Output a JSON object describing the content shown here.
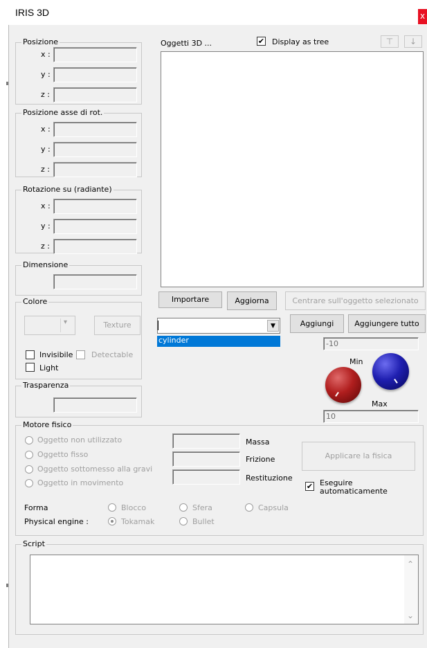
{
  "window": {
    "title": "IRIS 3D",
    "close_glyph": "x"
  },
  "left": {
    "posizione": {
      "legend": "Posizione",
      "labels": [
        "x :",
        "y :",
        "z :"
      ]
    },
    "asse": {
      "legend": "Posizione asse di rot.",
      "labels": [
        "x :",
        "y :",
        "z :"
      ]
    },
    "rotazione": {
      "legend": "Rotazione su (radiante)",
      "labels": [
        "x :",
        "y :",
        "z :"
      ]
    },
    "dimensione": {
      "legend": "Dimensione"
    },
    "colore": {
      "legend": "Colore",
      "texture": "Texture",
      "invisibile": "Invisibile",
      "detectable": "Detectable",
      "light": "Light"
    },
    "trasparenza": {
      "legend": "Trasparenza"
    }
  },
  "objects": {
    "label": "Oggetti 3D ...",
    "display_tree": "Display as tree",
    "display_tree_checked": true,
    "up_icon": "up-arrow-icon",
    "down_icon": "down-arrow-icon"
  },
  "actions": {
    "importare": "Importare",
    "aggiorna": "Aggiorna",
    "centrare": "Centrare sull'oggetto selezionato",
    "aggiungi": "Aggiungi",
    "aggiungere_tutto": "Aggiungere tutto"
  },
  "combo": {
    "value": "",
    "option": "cylinder"
  },
  "range": {
    "min_value": "-10",
    "max_value": "10",
    "min_label": "Min",
    "max_label": "Max",
    "min_knob_color": "#b01e1e",
    "max_knob_color": "#1f1fb0"
  },
  "physics": {
    "legend": "Motore fisico",
    "options": [
      "Oggetto non utilizzato",
      "Oggetto fisso",
      "Oggetto sottomesso alla gravi",
      "Oggetto in movimento"
    ],
    "fields": [
      "Massa",
      "Frizione",
      "Restituzione"
    ],
    "apply": "Applicare la fisica",
    "auto_line1": "Eseguire",
    "auto_line2": "automaticamente",
    "auto_checked": true,
    "forma_label": "Forma",
    "forma_options": [
      "Blocco",
      "Sfera",
      "Capsula"
    ],
    "engine_label": "Physical engine :",
    "engine_options": [
      "Tokamak",
      "Bullet"
    ],
    "engine_selected": "Tokamak"
  },
  "script": {
    "legend": "Script"
  }
}
